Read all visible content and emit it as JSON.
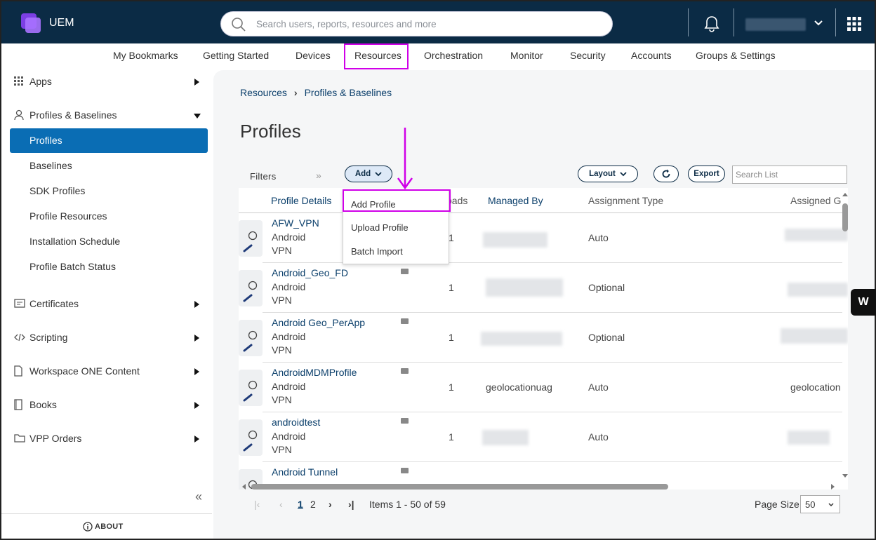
{
  "app": {
    "name": "UEM"
  },
  "search": {
    "placeholder": "Search users, reports, resources and more"
  },
  "nav": {
    "items": [
      "My Bookmarks",
      "Getting Started",
      "Devices",
      "Resources",
      "Orchestration",
      "Monitor",
      "Security",
      "Accounts",
      "Groups & Settings"
    ],
    "active": "Resources"
  },
  "sidebar": {
    "apps": "Apps",
    "profiles_baselines": "Profiles & Baselines",
    "sub": [
      "Profiles",
      "Baselines",
      "SDK Profiles",
      "Profile Resources",
      "Installation Schedule",
      "Profile Batch Status"
    ],
    "certificates": "Certificates",
    "scripting": "Scripting",
    "workspace": "Workspace ONE Content",
    "books": "Books",
    "vpp": "VPP Orders",
    "about": "ABOUT"
  },
  "breadcrumb": {
    "root": "Resources",
    "current": "Profiles & Baselines"
  },
  "page": {
    "title": "Profiles"
  },
  "toolbar": {
    "filters": "Filters",
    "add": "Add",
    "layout": "Layout",
    "export": "Export",
    "search_placeholder": "Search List"
  },
  "add_menu": [
    "Add Profile",
    "Upload Profile",
    "Batch Import"
  ],
  "table": {
    "headers": {
      "details": "Profile Details",
      "payloads": "oads",
      "managed_by": "Managed By",
      "assignment_type": "Assignment Type",
      "assigned_groups": "Assigned G"
    },
    "rows": [
      {
        "name": "AFW_VPN",
        "os": "Android",
        "type": "VPN",
        "count": "1",
        "managed_by": "",
        "assignment": "Auto",
        "group": ""
      },
      {
        "name": "Android_Geo_FD",
        "os": "Android",
        "type": "VPN",
        "count": "1",
        "managed_by": "",
        "assignment": "Optional",
        "group": ""
      },
      {
        "name": "Android Geo_PerApp",
        "os": "Android",
        "type": "VPN",
        "count": "1",
        "managed_by": "",
        "assignment": "Optional",
        "group": ""
      },
      {
        "name": "AndroidMDMProfile",
        "os": "Android",
        "type": "VPN",
        "count": "1",
        "managed_by": "geolocationuag",
        "assignment": "Auto",
        "group": "geolocation"
      },
      {
        "name": "androidtest",
        "os": "Android",
        "type": "VPN",
        "count": "1",
        "managed_by": "",
        "assignment": "Auto",
        "group": ""
      },
      {
        "name": "Android Tunnel",
        "os": "",
        "type": "",
        "count": "",
        "managed_by": "",
        "assignment": "",
        "group": ""
      }
    ]
  },
  "pager": {
    "page1": "1",
    "page2": "2",
    "items": "Items 1 - 50 of 59",
    "page_size_label": "Page Size:",
    "page_size": "50"
  },
  "colors": {
    "topbar": "#0b2b45",
    "active": "#0a6db4",
    "annotation": "#d000e8"
  }
}
